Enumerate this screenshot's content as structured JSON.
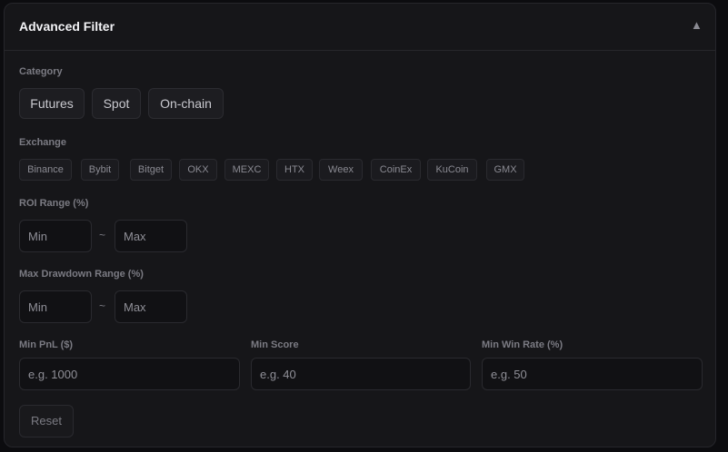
{
  "header": {
    "title": "Advanced Filter",
    "collapse_icon": "▲"
  },
  "category": {
    "label": "Category",
    "options": [
      "Futures",
      "Spot",
      "On-chain"
    ]
  },
  "exchange": {
    "label": "Exchange",
    "options": [
      "Binance",
      "Bybit",
      "Bitget",
      "OKX",
      "MEXC",
      "HTX",
      "Weex",
      "CoinEx",
      "KuCoin",
      "GMX"
    ]
  },
  "roi": {
    "label": "ROI Range (%)",
    "min_placeholder": "Min",
    "max_placeholder": "Max",
    "separator": "~"
  },
  "drawdown": {
    "label": "Max Drawdown Range (%)",
    "min_placeholder": "Min",
    "max_placeholder": "Max",
    "separator": "~"
  },
  "min_pnl": {
    "label": "Min PnL ($)",
    "placeholder": "e.g. 1000"
  },
  "min_score": {
    "label": "Min Score",
    "placeholder": "e.g. 40"
  },
  "min_win_rate": {
    "label": "Min Win Rate (%)",
    "placeholder": "e.g. 50"
  },
  "reset_label": "Reset"
}
